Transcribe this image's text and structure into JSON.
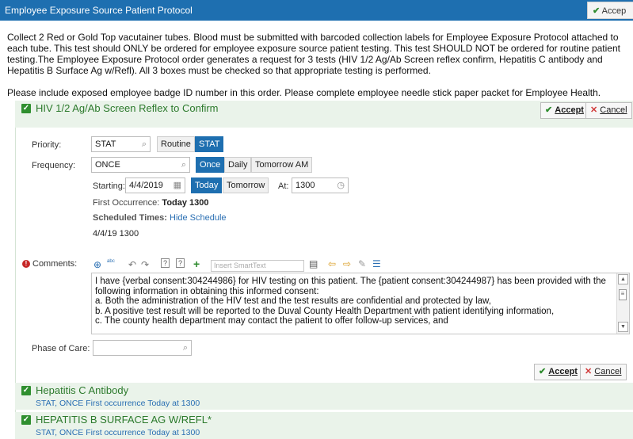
{
  "window": {
    "title": "Employee Exposure Source Patient Protocol",
    "accept_top": "Accep"
  },
  "instructions": {
    "p1": "Collect 2 Red or Gold Top vacutainer tubes.  Blood must be submitted with barcoded collection labels for Employee Exposure Protocol attached to each tube. This test should ONLY be ordered for employee exposure source patient testing. This test SHOULD NOT be ordered for routine patient testing.The Employee Exposure Protocol order generates a request for 3 tests (HIV 1/2 Ag/Ab Screen reflex confirm, Hepatitis C antibody and Hepatitis B Surface Ag w/Refl).  All 3 boxes must be checked so that appropriate testing is performed.",
    "p2": "Please include exposed employee badge ID number in this order. Please complete employee needle stick paper packet for Employee Health."
  },
  "order1": {
    "title": "HIV 1/2 Ag/Ab Screen Reflex to Confirm",
    "accept": "Accept",
    "cancel": "Cancel",
    "priority_label": "Priority:",
    "priority_value": "STAT",
    "priority_options": [
      "Routine",
      "STAT"
    ],
    "frequency_label": "Frequency:",
    "frequency_value": "ONCE",
    "frequency_options": [
      "Once",
      "Daily",
      "Tomorrow AM"
    ],
    "starting_label": "Starting:",
    "starting_value": "4/4/2019",
    "start_options": [
      "Today",
      "Tomorrow"
    ],
    "at_label": "At:",
    "at_value": "1300",
    "first_occurrence_label": "First Occurrence:",
    "first_occurrence_value": "Today 1300",
    "scheduled_label": "Scheduled Times:",
    "hide_schedule": "Hide Schedule",
    "schedule_entry": "4/4/19 1300",
    "comments_label": "Comments:",
    "smarttext_placeholder": "Insert SmartText",
    "comments_lines": [
      "I have {verbal consent:304244986} for HIV testing on this patient.  The {patient consent:304244987} has been provided with the following information in obtaining this informed consent:",
      "a. Both the administration of the HIV test and the test results are confidential and protected by law,",
      "b. A positive test result will be reported to the Duval County Health Department with patient identifying information,",
      "c. The county health department may contact the patient to offer follow-up services, and"
    ],
    "phase_label": "Phase of Care:",
    "phase_value": ""
  },
  "order2": {
    "title": "Hepatitis C Antibody",
    "sub": "STAT, ONCE First occurrence Today at 1300"
  },
  "order3": {
    "title": "HEPATITIS B SURFACE AG W/REFL*",
    "sub": "STAT, ONCE First occurrence Today at 1300"
  },
  "colors": {
    "titlebar": "#1e6fb0",
    "accent_green": "#2c7a2c",
    "section_bg": "#eaf3ea",
    "link": "#2a6fb3"
  }
}
